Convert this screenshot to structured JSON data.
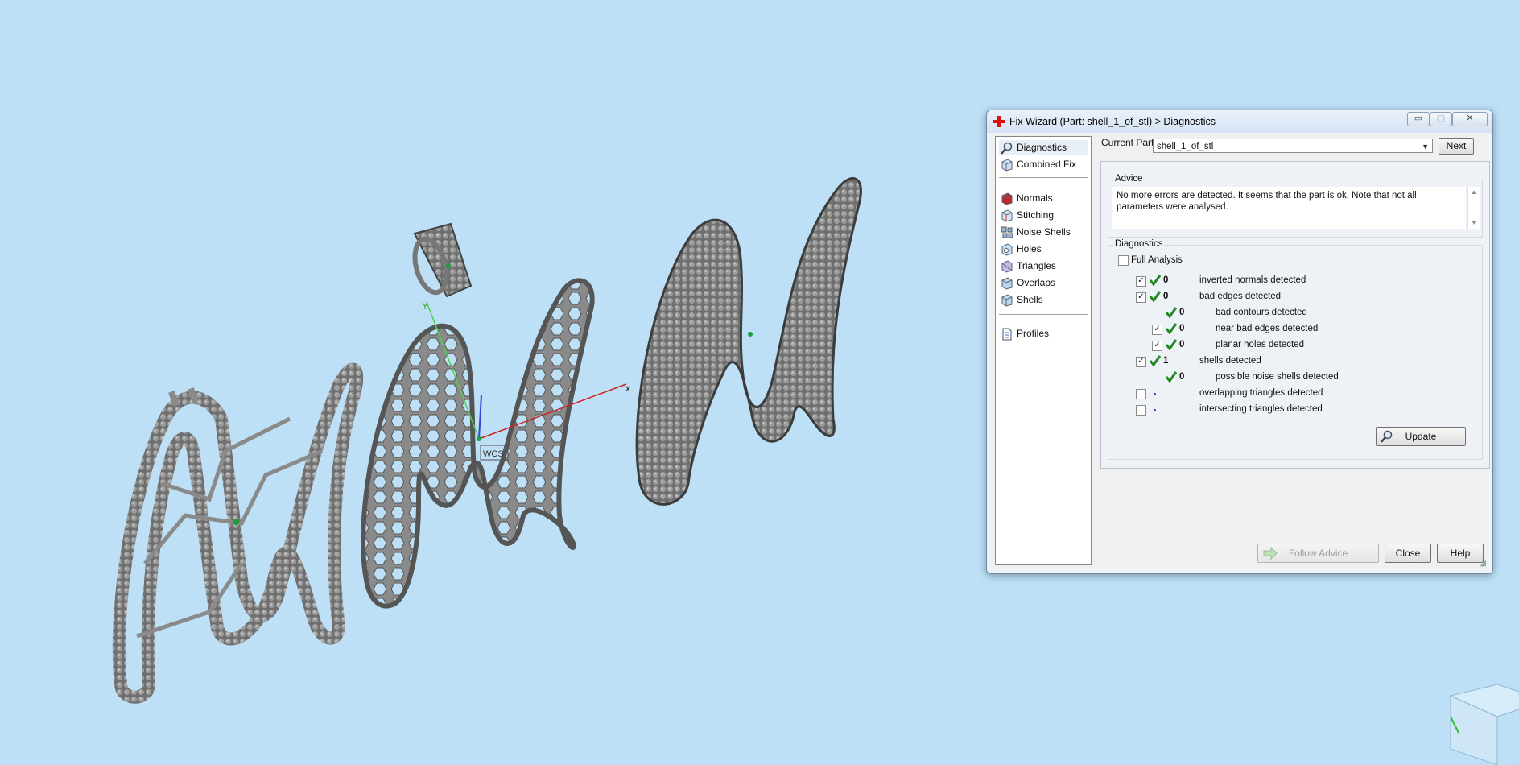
{
  "viewport": {
    "axis_x_label": "x",
    "axis_y_label": "Y",
    "wcs_label": "WCS",
    "background": "#bde0f7"
  },
  "dialog": {
    "title": "Fix Wizard (Part: shell_1_of_stl) > Diagnostics",
    "title_icon": "red-cross-icon",
    "window_buttons": {
      "minimize": "▭",
      "maximize": "▢",
      "close": "✕"
    },
    "nav": {
      "top_items": [
        {
          "label": "Diagnostics",
          "icon": "magnifier-icon",
          "selected": true
        },
        {
          "label": "Combined Fix",
          "icon": "cube-icon"
        }
      ],
      "tool_items": [
        {
          "label": "Normals",
          "icon": "normals-cube-icon"
        },
        {
          "label": "Stitching",
          "icon": "stitching-cube-icon"
        },
        {
          "label": "Noise Shells",
          "icon": "noise-shells-icon"
        },
        {
          "label": "Holes",
          "icon": "holes-cube-icon"
        },
        {
          "label": "Triangles",
          "icon": "triangles-cube-icon"
        },
        {
          "label": "Overlaps",
          "icon": "overlaps-cube-icon"
        },
        {
          "label": "Shells",
          "icon": "shells-cube-icon"
        }
      ],
      "bottom_items": [
        {
          "label": "Profiles",
          "icon": "document-icon"
        }
      ]
    },
    "current_part_label": "Current Part:",
    "current_part_value": "shell_1_of_stl",
    "next_button": "Next",
    "advice": {
      "title": "Advice",
      "text": "No more errors are detected. It seems that the part is ok. Note that not all parameters were analysed."
    },
    "diagnostics": {
      "title": "Diagnostics",
      "full_analysis_label": "Full Analysis",
      "full_analysis_checked": false,
      "rows": [
        {
          "checkbox": true,
          "checked": true,
          "status": "ok",
          "count": "0",
          "label": "inverted normals detected",
          "indent": 0
        },
        {
          "checkbox": true,
          "checked": true,
          "status": "ok",
          "count": "0",
          "label": "bad edges detected",
          "indent": 0
        },
        {
          "checkbox": false,
          "checked": false,
          "status": "ok",
          "count": "0",
          "label": "bad contours detected",
          "indent": 1
        },
        {
          "checkbox": true,
          "checked": true,
          "status": "ok",
          "count": "0",
          "label": "near bad edges detected",
          "indent": 1
        },
        {
          "checkbox": true,
          "checked": true,
          "status": "ok",
          "count": "0",
          "label": "planar holes detected",
          "indent": 1
        },
        {
          "checkbox": true,
          "checked": true,
          "status": "ok",
          "count": "1",
          "label": "shells detected",
          "indent": 0
        },
        {
          "checkbox": false,
          "checked": false,
          "status": "ok",
          "count": "0",
          "label": "possible noise shells detected",
          "indent": 1
        },
        {
          "checkbox": true,
          "checked": false,
          "status": "unknown",
          "count": "",
          "label": "overlapping triangles detected",
          "indent": 0
        },
        {
          "checkbox": true,
          "checked": false,
          "status": "unknown",
          "count": "",
          "label": "intersecting triangles detected",
          "indent": 0
        }
      ],
      "update_button": "Update"
    },
    "follow_advice_button": "Follow Advice",
    "follow_advice_enabled": false,
    "close_button": "Close",
    "help_button": "Help"
  },
  "colors": {
    "check_green": "#1f8a1f",
    "dot_blue": "#1a3cc8",
    "model_gray": "#8a8a8a"
  }
}
